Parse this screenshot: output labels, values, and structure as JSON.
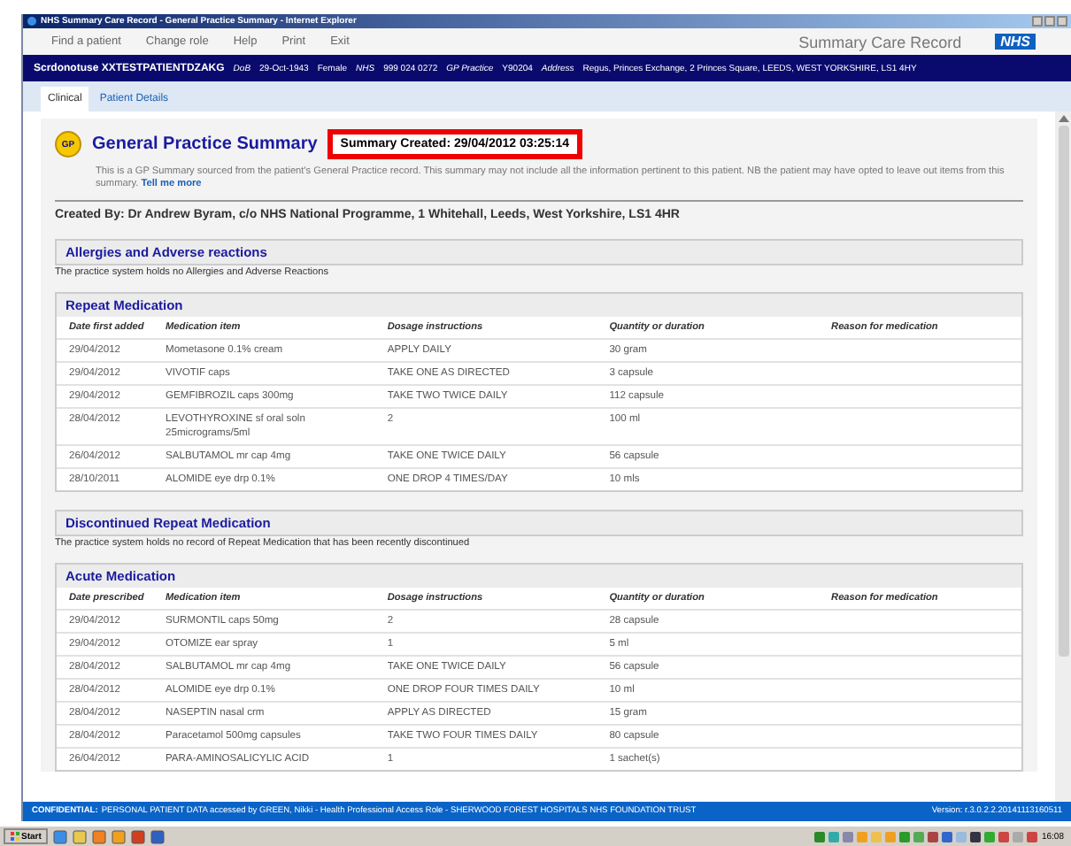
{
  "window": {
    "title": "NHS Summary Care Record - General Practice Summary - Internet Explorer"
  },
  "menu": [
    "Find a patient",
    "Change role",
    "Help",
    "Print",
    "Exit"
  ],
  "brand": {
    "title": "Summary Care Record",
    "logo": "NHS"
  },
  "patient": {
    "name": "Scrdonotuse XXTESTPATIENTDZAKG",
    "fields": [
      {
        "label": "DoB",
        "value": "29-Oct-1943"
      },
      {
        "value": "Female"
      },
      {
        "label": "NHS",
        "value": "999 024 0272"
      },
      {
        "label": "GP Practice",
        "value": "Y90204"
      },
      {
        "label": "Address",
        "value": "Regus, Princes Exchange, 2 Princes Square, LEEDS, WEST YORKSHIRE, LS1 4HY"
      }
    ]
  },
  "tabs": [
    {
      "label": "Clinical",
      "selected": true
    },
    {
      "label": "Patient Details",
      "selected": false
    }
  ],
  "summary": {
    "badge": "GP",
    "title": "General Practice Summary",
    "created": "Summary Created: 29/04/2012 03:25:14",
    "note": "This is a GP Summary sourced from the patient's General Practice record. This summary may not include all the information pertinent to this patient. NB the patient may have opted to leave out items from this summary.",
    "link": "Tell me more",
    "created_by": "Created By: Dr Andrew Byram, c/o NHS National Programme, 1 Whitehall, Leeds, West Yorkshire, LS1 4HR"
  },
  "sections": [
    {
      "kind": "note",
      "title": "Allergies and Adverse reactions",
      "text": "The practice system holds no Allergies and Adverse Reactions"
    },
    {
      "kind": "table",
      "title": "Repeat Medication",
      "columns": [
        "Date first added",
        "Medication item",
        "Dosage instructions",
        "Quantity or duration",
        "Reason for medication"
      ],
      "rows": [
        [
          "29/04/2012",
          "Mometasone 0.1% cream",
          "APPLY DAILY",
          "30 gram"
        ],
        [
          "29/04/2012",
          "VIVOTIF caps",
          "TAKE ONE AS DIRECTED",
          "3 capsule"
        ],
        [
          "29/04/2012",
          "GEMFIBROZIL caps 300mg",
          "TAKE TWO TWICE DAILY",
          "112 capsule"
        ],
        [
          "28/04/2012",
          "LEVOTHYROXINE sf oral soln 25micrograms/5ml",
          "2",
          "100 ml"
        ],
        [
          "26/04/2012",
          "SALBUTAMOL mr cap 4mg",
          "TAKE ONE TWICE DAILY",
          "56 capsule"
        ],
        [
          "28/10/2011",
          "ALOMIDE eye drp 0.1%",
          "ONE DROP 4 TIMES/DAY",
          "10 mls"
        ]
      ]
    },
    {
      "kind": "note",
      "title": "Discontinued Repeat Medication",
      "text": "The practice system holds no record of Repeat Medication that has been recently discontinued"
    },
    {
      "kind": "table",
      "title": "Acute Medication",
      "columns": [
        "Date prescribed",
        "Medication item",
        "Dosage instructions",
        "Quantity or duration",
        "Reason for medication"
      ],
      "rows": [
        [
          "29/04/2012",
          "SURMONTIL caps 50mg",
          "2",
          "28 capsule"
        ],
        [
          "29/04/2012",
          "OTOMIZE ear spray",
          "1",
          "5 ml"
        ],
        [
          "28/04/2012",
          "SALBUTAMOL mr cap 4mg",
          "TAKE ONE TWICE DAILY",
          "56 capsule"
        ],
        [
          "28/04/2012",
          "ALOMIDE eye drp 0.1%",
          "ONE DROP FOUR TIMES DAILY",
          "10 ml"
        ],
        [
          "28/04/2012",
          "NASEPTIN nasal crm",
          "APPLY AS DIRECTED",
          "15 gram"
        ],
        [
          "28/04/2012",
          "Paracetamol 500mg capsules",
          "TAKE TWO FOUR TIMES DAILY",
          "80 capsule"
        ],
        [
          "26/04/2012",
          "PARA-AMINOSALICYLIC ACID",
          "1",
          "1 sachet(s)"
        ]
      ]
    }
  ],
  "status": {
    "label": "CONFIDENTIAL:",
    "text": "PERSONAL PATIENT DATA accessed by GREEN, Nikki - Health Professional Access Role - SHERWOOD FOREST HOSPITALS NHS FOUNDATION TRUST",
    "version": "Version: r.3.0.2.2.20141113160511"
  },
  "taskbar": {
    "start": "Start",
    "clock": "16:08"
  }
}
